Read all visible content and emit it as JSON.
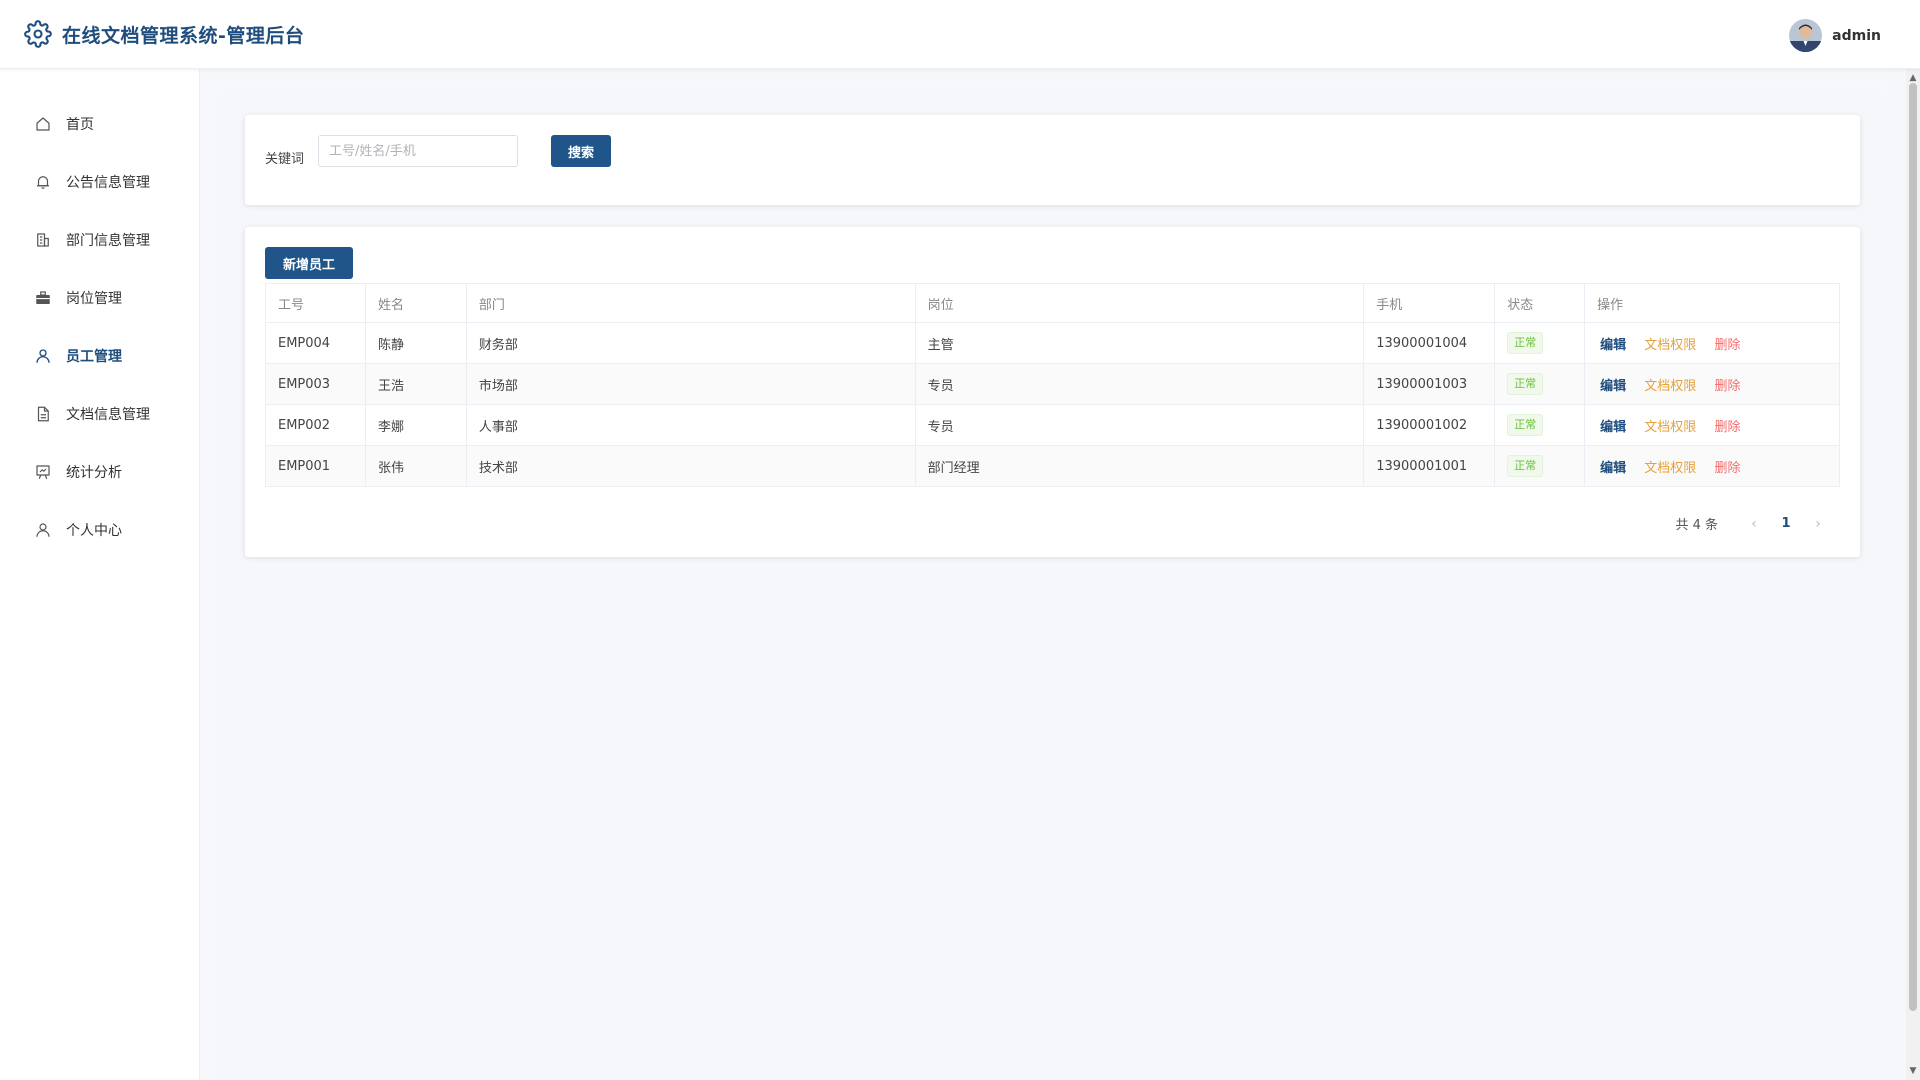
{
  "header": {
    "title": "在线文档管理系统-管理后台",
    "username": "admin"
  },
  "sidebar": {
    "items": [
      {
        "label": "首页",
        "icon": "home-icon"
      },
      {
        "label": "公告信息管理",
        "icon": "bell-icon"
      },
      {
        "label": "部门信息管理",
        "icon": "building-icon"
      },
      {
        "label": "岗位管理",
        "icon": "briefcase-icon"
      },
      {
        "label": "员工管理",
        "icon": "user-icon",
        "active": true
      },
      {
        "label": "文档信息管理",
        "icon": "document-icon"
      },
      {
        "label": "统计分析",
        "icon": "chart-icon"
      },
      {
        "label": "个人中心",
        "icon": "user-icon"
      }
    ]
  },
  "search": {
    "label": "关键词",
    "placeholder": "工号/姓名/手机",
    "value": "",
    "button": "搜索"
  },
  "table": {
    "add_button": "新增员工",
    "columns": [
      "工号",
      "姓名",
      "部门",
      "岗位",
      "手机",
      "状态",
      "操作"
    ],
    "rows": [
      {
        "id": "EMP004",
        "name": "陈静",
        "dept": "财务部",
        "position": "主管",
        "phone": "13900001004",
        "status": "正常"
      },
      {
        "id": "EMP003",
        "name": "王浩",
        "dept": "市场部",
        "position": "专员",
        "phone": "13900001003",
        "status": "正常"
      },
      {
        "id": "EMP002",
        "name": "李娜",
        "dept": "人事部",
        "position": "专员",
        "phone": "13900001002",
        "status": "正常"
      },
      {
        "id": "EMP001",
        "name": "张伟",
        "dept": "技术部",
        "position": "部门经理",
        "phone": "13900001001",
        "status": "正常"
      }
    ],
    "actions": {
      "edit": "编辑",
      "permission": "文档权限",
      "delete": "删除"
    }
  },
  "pagination": {
    "total": "共 4 条",
    "current_page": "1",
    "prev": "‹",
    "next": "›"
  },
  "colors": {
    "primary": "#1f5589",
    "brand_text": "#1f4e7e",
    "warning": "#e6a23c",
    "danger": "#f56c6c",
    "success": "#67c23a"
  }
}
